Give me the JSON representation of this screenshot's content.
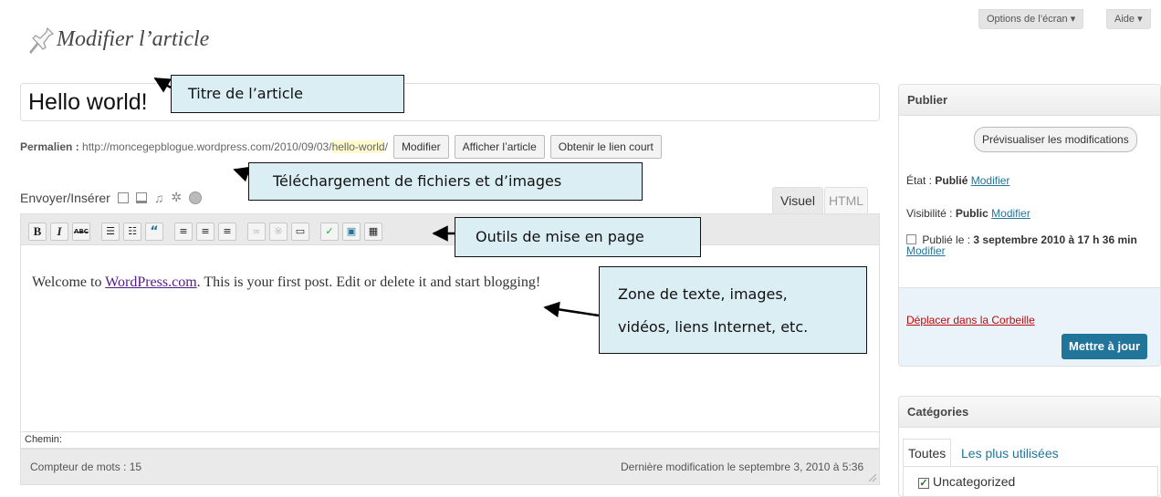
{
  "screen_options": {
    "options_label": "Options de l’écran ▾",
    "help_label": "Aide ▾"
  },
  "page": {
    "title": "Modifier l’article"
  },
  "post": {
    "title": "Hello world!",
    "permalink_label": "Permalien :",
    "permalink_base": "http://moncegepblogue.wordpress.com/2010/09/03/",
    "permalink_slug": "hello-world",
    "permalink_end": "/",
    "buttons": {
      "modify": "Modifier",
      "view": "Afficher l’article",
      "shortlink": "Obtenir le lien court"
    }
  },
  "upload": {
    "label": "Envoyer/Insérer"
  },
  "tabs": {
    "visual": "Visuel",
    "html": "HTML"
  },
  "toolbar": {
    "bold": "B",
    "italic": "I",
    "strike": "ABC",
    "quote": "“"
  },
  "content": {
    "prefix": "Welcome to ",
    "link": "WordPress.com",
    "suffix": ". This is your first post. Edit or delete it and start blogging!"
  },
  "status": {
    "path_label": "Chemin:",
    "word_count": "Compteur de mots : 15",
    "last_modified": "Dernière modification le septembre 3, 2010 à 5:36"
  },
  "publish": {
    "heading": "Publier",
    "preview_button": "Prévisualiser les modifications",
    "state_label": "État :",
    "state_value": "Publié",
    "visibility_label": "Visibilité :",
    "visibility_value": "Public",
    "edit_link": "Modifier",
    "published_label": "Publié le :",
    "published_value": "3 septembre 2010 à 17 h 36 min",
    "trash_link": "Déplacer dans la Corbeille",
    "update_button": "Mettre à jour"
  },
  "categories": {
    "heading": "Catégories",
    "tab_all": "Toutes",
    "tab_popular": "Les plus utilisées",
    "items": [
      {
        "label": "Uncategorized",
        "checked": true
      }
    ]
  },
  "annotations": {
    "title": "Titre de l’article",
    "upload": "Téléchargement de fichiers et d’images",
    "toolbar": "Outils de mise en page",
    "content_line1": "Zone de texte, images,",
    "content_line2": "vidéos, liens Internet, etc."
  },
  "colors": {
    "link": "#21759b",
    "callout_bg": "#dbeef4",
    "update_button": "#21759b"
  }
}
